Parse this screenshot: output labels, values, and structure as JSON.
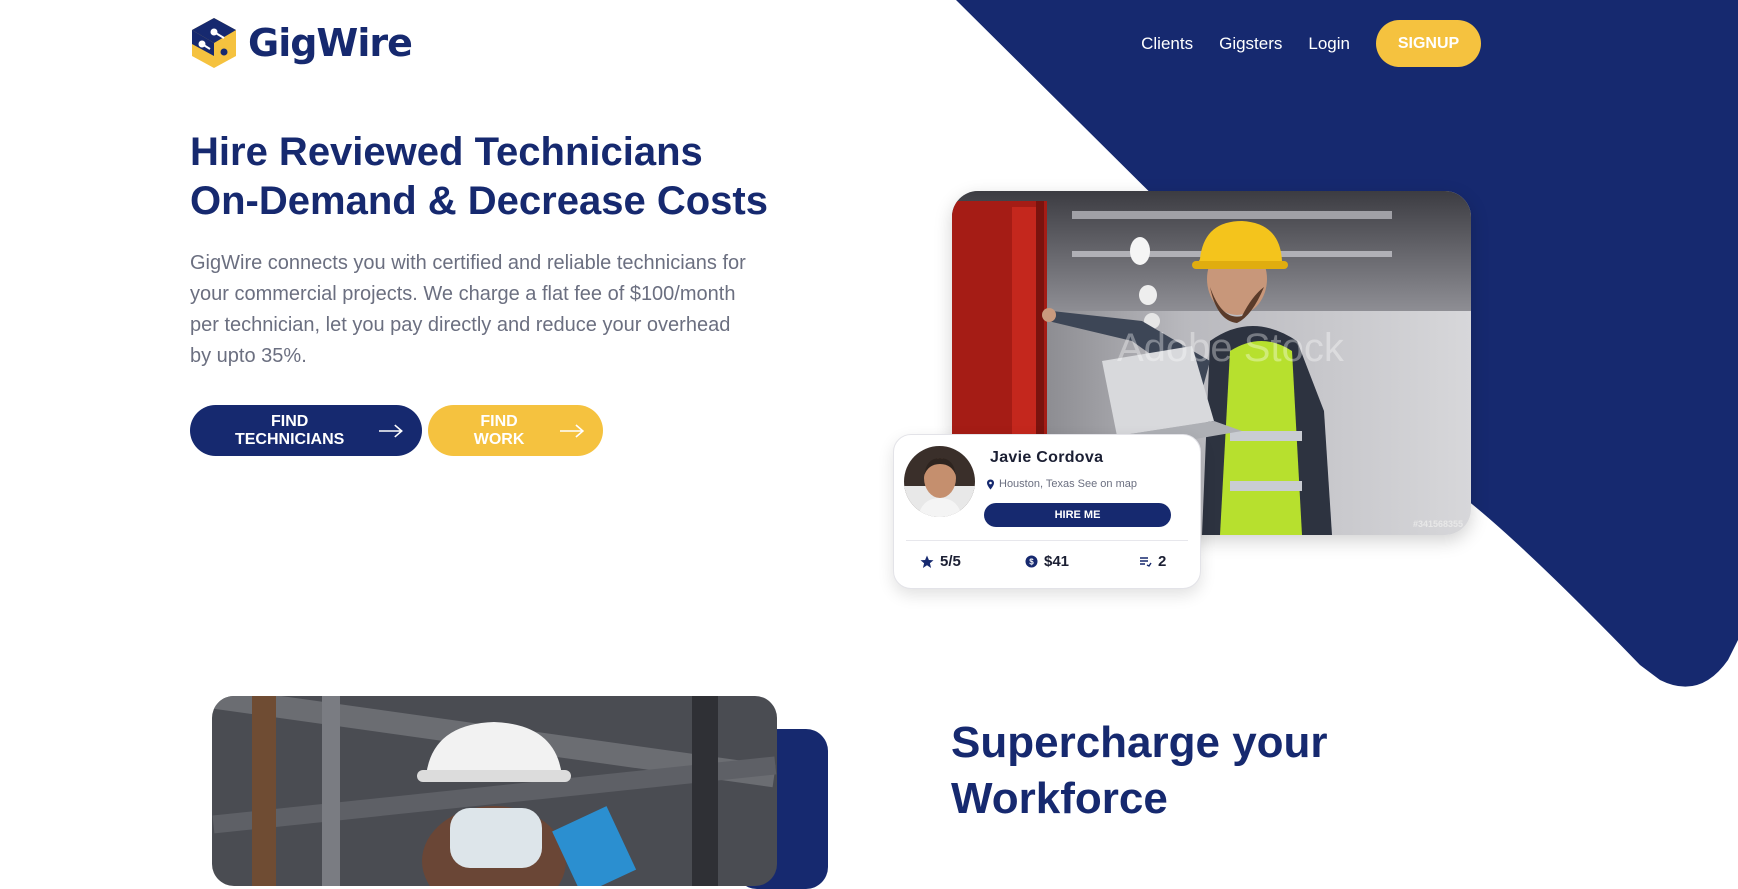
{
  "brand": {
    "name": "GigWire"
  },
  "nav": {
    "links": [
      "Clients",
      "Gigsters",
      "Login"
    ],
    "signup_label": "SIGNUP"
  },
  "hero": {
    "title_line1": "Hire Reviewed Technicians",
    "title_line2": "On-Demand & Decrease Costs",
    "description": "GigWire connects you with certified and reliable technicians for your commercial projects. We charge a flat fee of $100/month per technician, let you pay directly and reduce your overhead by upto 35%.",
    "find_technicians_label": "FIND TECHNICIANS",
    "find_work_label": "FIND WORK"
  },
  "photo": {
    "watermark_id": "#341568355"
  },
  "profile_card": {
    "name": "Javie Cordova",
    "location": "Houston, Texas See on map",
    "hire_label": "HIRE ME",
    "rating": "5/5",
    "rate": "$41",
    "jobs": "2",
    "icons": [
      "star-icon",
      "dollar-coin-icon",
      "list-icon",
      "location-pin-icon"
    ]
  },
  "section2": {
    "title_line1": "Supercharge your",
    "title_line2": "Workforce"
  },
  "colors": {
    "navy": "#16296f",
    "yellow": "#f5c23f",
    "text_muted": "#6b6f80"
  }
}
